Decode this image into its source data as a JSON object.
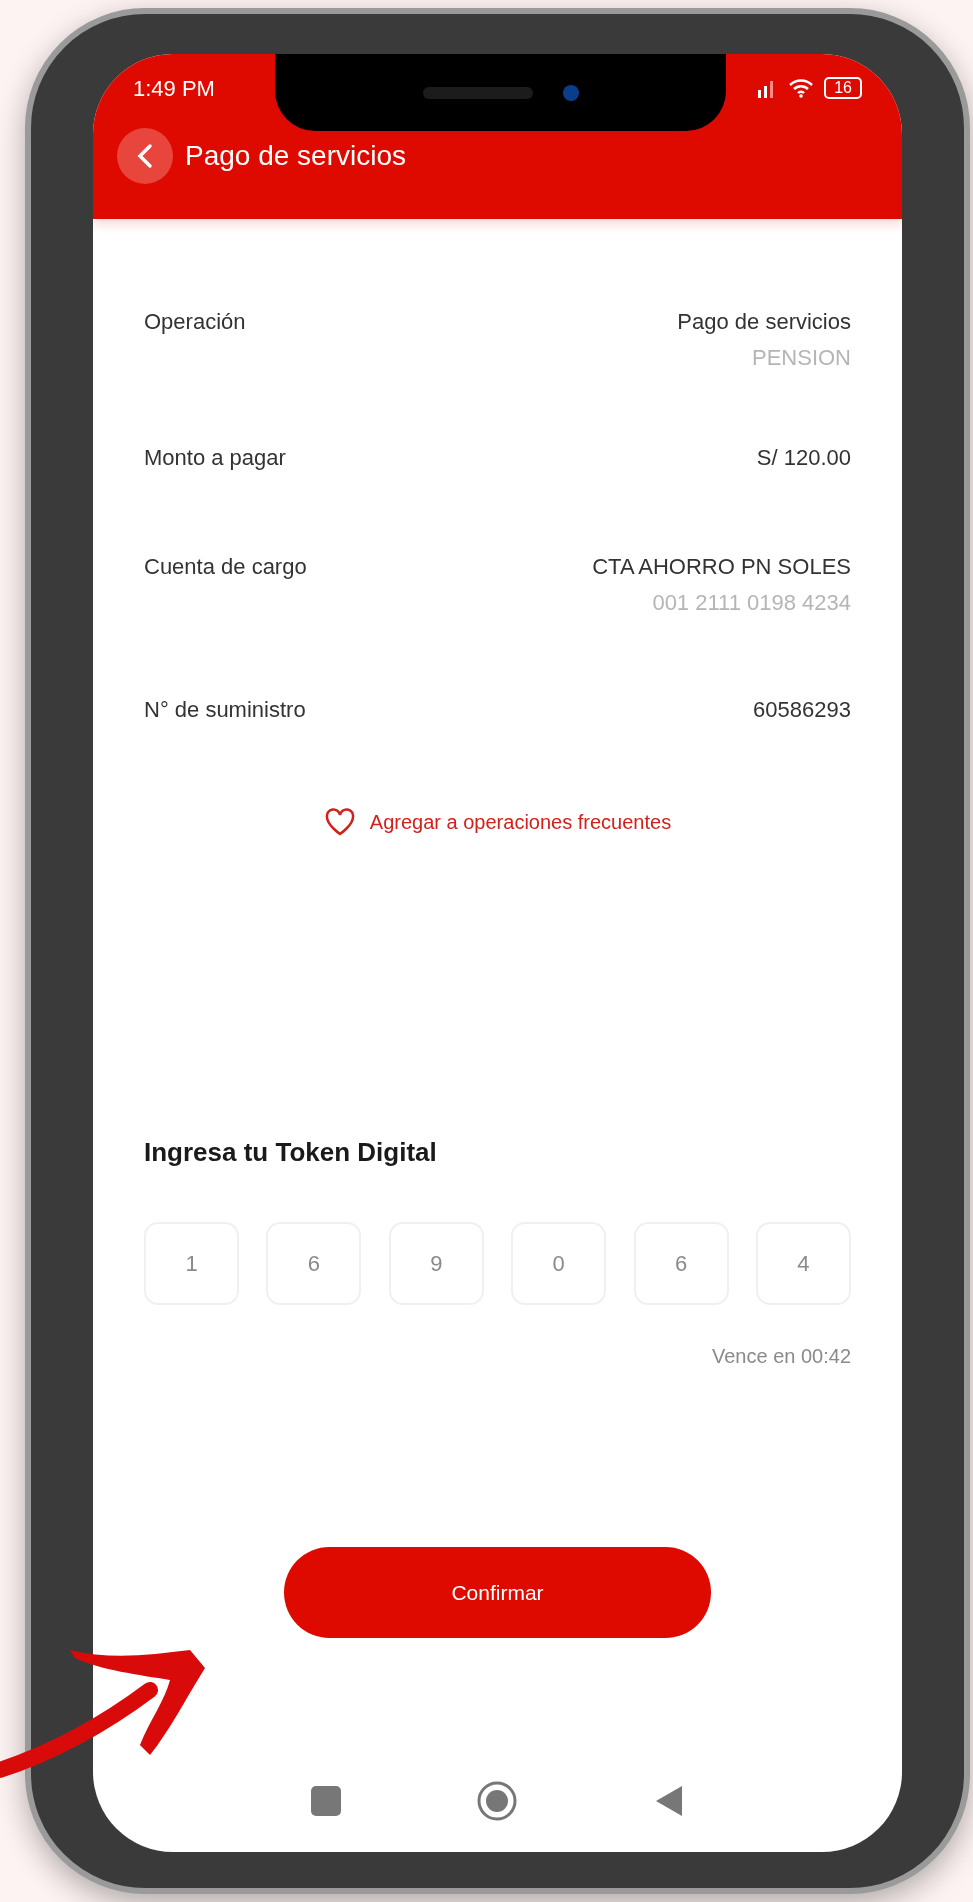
{
  "status_bar": {
    "time": "1:49 PM",
    "battery": "16"
  },
  "header": {
    "title": "Pago de servicios"
  },
  "details": [
    {
      "label": "Operación",
      "value": "Pago de servicios",
      "detail": "PENSION"
    },
    {
      "label": "Monto a pagar",
      "value": "S/ 120.00"
    },
    {
      "label": "Cuenta de cargo",
      "value": "CTA AHORRO PN SOLES",
      "detail": "001 2111 0198 4234"
    },
    {
      "label": "N° de suministro",
      "value": "60586293"
    }
  ],
  "favorite_link": {
    "label": "Agregar a operaciones frecuentes"
  },
  "token": {
    "title": "Ingresa tu Token Digital",
    "digits": [
      "1",
      "6",
      "9",
      "0",
      "6",
      "4"
    ],
    "expiry": "Vence en 00:42"
  },
  "confirm_button": {
    "label": "Confirmar"
  }
}
